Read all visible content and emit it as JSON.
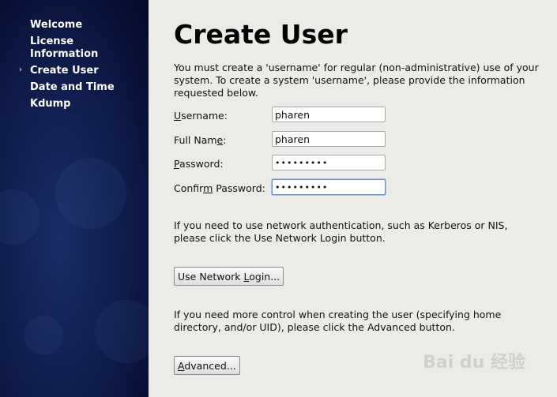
{
  "sidebar": {
    "items": [
      {
        "label": "Welcome"
      },
      {
        "label": "License Information"
      },
      {
        "label": "Create User",
        "active": true
      },
      {
        "label": "Date and Time"
      },
      {
        "label": "Kdump"
      }
    ],
    "active_marker": "›"
  },
  "main": {
    "title": "Create User",
    "intro": "You must create a 'username' for regular (non-administrative) use of your system.  To create a system 'username', please provide the information requested below.",
    "fields": {
      "username": {
        "label_pre": "",
        "label_u": "U",
        "label_post": "sername:",
        "value": "pharen"
      },
      "fullname": {
        "label_pre": "Full Nam",
        "label_u": "e",
        "label_post": ":",
        "value": "pharen"
      },
      "password": {
        "label_pre": "",
        "label_u": "P",
        "label_post": "assword:",
        "value": "•••••••••"
      },
      "confirm": {
        "label_pre": "Confir",
        "label_u": "m",
        "label_post": " Password:",
        "value": "•••••••••"
      }
    },
    "network_text": "If you need to use network authentication, such as Kerberos or NIS, please click the Use Network Login button.",
    "network_button": {
      "pre": "Use Network ",
      "u": "L",
      "post": "ogin..."
    },
    "advanced_text": "If you need more control when creating the user (specifying home directory, and/or UID), please click the Advanced button.",
    "advanced_button": {
      "pre": "",
      "u": "A",
      "post": "dvanced..."
    }
  },
  "watermark": "Bai du 经验"
}
